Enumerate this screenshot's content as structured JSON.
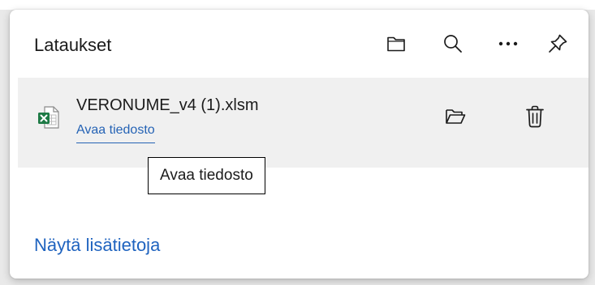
{
  "header": {
    "title": "Lataukset",
    "buttons": [
      {
        "icon": "open-downloads-folder-icon"
      },
      {
        "icon": "search-icon"
      },
      {
        "icon": "more-options-icon"
      },
      {
        "icon": "pin-icon"
      }
    ]
  },
  "download": {
    "file_name": "VERONUME_v4 (1).xlsm",
    "file_icon": "excel-file-icon",
    "open_link": "Avaa tiedosto",
    "actions": [
      {
        "icon": "show-in-folder-icon"
      },
      {
        "icon": "delete-icon"
      }
    ]
  },
  "tooltip": {
    "text": "Avaa tiedosto"
  },
  "footer": {
    "more_link": "Näytä lisätietoja"
  },
  "colors": {
    "link": "#2563b5",
    "item_background": "#f0f0f0",
    "excel_green": "#1d7a45"
  }
}
